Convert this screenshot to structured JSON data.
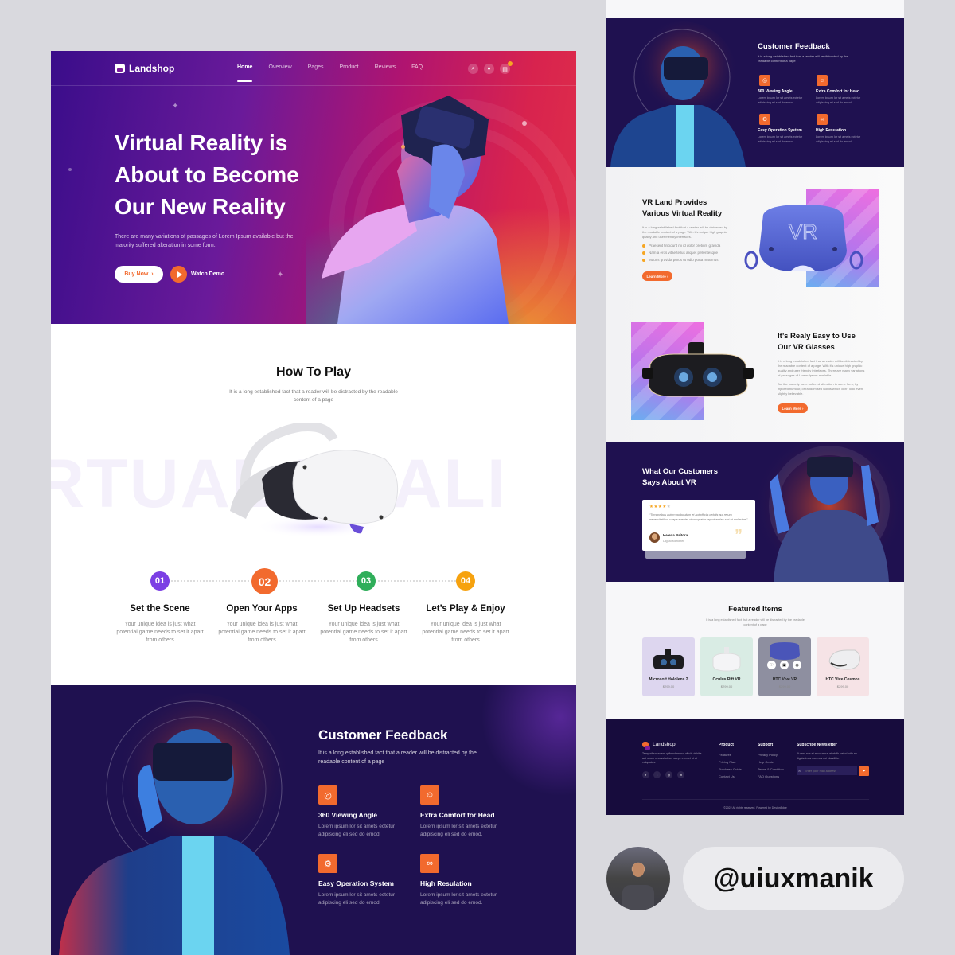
{
  "brand": "Landshop",
  "nav": {
    "links": [
      "Home",
      "Overview",
      "Pages",
      "Product",
      "Reviews",
      "FAQ"
    ],
    "active": "Home",
    "icons": [
      "search-icon",
      "user-icon",
      "cart-icon"
    ]
  },
  "hero": {
    "title_lines": [
      "Virtual Reality is",
      "About to Become",
      "Our New Reality"
    ],
    "subtitle": "There are many variations of passages of Lorem Ipsum available but the majority suffered alteration in some form.",
    "buy_label": "Buy Now",
    "watch_label": "Watch Demo"
  },
  "how_to_play": {
    "title": "How To Play",
    "subtitle": "It is a long established fact that a reader will be distracted by the readable content of a page",
    "bg_word": "RTUAL REALI",
    "steps": [
      {
        "num": "01",
        "title": "Set the Scene",
        "desc": "Your unique idea is just what potential game needs to set it apart from others",
        "color": "#7b3fe4"
      },
      {
        "num": "02",
        "title": "Open Your Apps",
        "desc": "Your unique idea is just what potential game needs to set it apart from others",
        "color": "#f26a2e"
      },
      {
        "num": "03",
        "title": "Set Up Headsets",
        "desc": "Your unique idea is just what potential game needs to set it apart from others",
        "color": "#2fae5a"
      },
      {
        "num": "04",
        "title": "Let’s Play & Enjoy",
        "desc": "Your unique idea is just what potential game needs to set it apart from others",
        "color": "#f6a20f"
      }
    ]
  },
  "feedback": {
    "title": "Customer Feedback",
    "subtitle": "It is a long established fact that a reader will be distracted by the readable content of a page",
    "features": [
      {
        "title": "360 Viewing Angle",
        "desc": "Lorem ipsum lor sit amets ectetur adipiscing eli sed do emod.",
        "icon": "vr-headset-icon"
      },
      {
        "title": "Extra Comfort for Head",
        "desc": "Lorem ipsum lor sit amets ectetur adipiscing eli sed do emod.",
        "icon": "head-comfort-icon"
      },
      {
        "title": "Easy Operation System",
        "desc": "Lorem ipsum lor sit amets ectetur adipiscing eli sed do emod.",
        "icon": "operation-icon"
      },
      {
        "title": "High Resulation",
        "desc": "Lorem ipsum lor sit amets ectetur adipiscing eli sed do emod.",
        "icon": "resolution-icon"
      }
    ]
  },
  "vr_land": {
    "title_lines": [
      "VR Land Provides",
      "Various Virtual Reality"
    ],
    "desc": "It is a long established fact that a reader will be distracted by the readable content of a page. With it's unique high graphic quality and user friendly interfaces.",
    "bullets": [
      "Praesent tincidunt mi id dolor pretium gravida",
      "Nam a eros vitae tellus aliquet pellentesque",
      "Mauris gravida purus ut odio porta maximus"
    ],
    "button": "Learn More",
    "visor_text": "VR"
  },
  "easy_use": {
    "title_lines": [
      "It’s Realy Easy to Use",
      "Our VR Glasses"
    ],
    "desc1": "It is a long established fact that a reader will be distracted by the readable content of a page. With it's unique high graphic quality and user friendly interfaces. There are many variations of passages of Lorem Ipsum available.",
    "desc2": "But the majority have suffered alteration in some form, by injected humour, or randomised words which don't look even slightly believable.",
    "button": "Learn More"
  },
  "testimonial": {
    "title_lines": [
      "What Our Customers",
      "Says About VR"
    ],
    "rating": 4,
    "rating_max": 5,
    "quote": "“Temporibus autem quibusdam et aut officiis debitis aut rerum necessitatibus saepe eveniet ut voluptates repudiandae sint et molestiae”",
    "name": "Helena Paitora",
    "role": "Digital Marketer"
  },
  "featured": {
    "title": "Featured Items",
    "subtitle": "It is a long established fact that a reader will be distracted by the readable content of a page",
    "items": [
      {
        "name": "Microsoft Hololens 2",
        "price": "$299.00",
        "bg": "#ddd6ef"
      },
      {
        "name": "Oculus Rift VR",
        "price": "$299.00",
        "bg": "#d9ece4"
      },
      {
        "name": "HTC Vive VR",
        "price": "$299.00",
        "bg": "#8e8fa0"
      },
      {
        "name": "HTC Vive Cosmos",
        "price": "$299.00",
        "bg": "#f6e3e6"
      }
    ]
  },
  "footer": {
    "about": "Temporibus autem quibusdam aut officiis debitis aut rerum necessitatibus saepe eveniet ut et voluptates.",
    "social": [
      "facebook-icon",
      "twitter-icon",
      "instagram-icon",
      "linkedin-icon"
    ],
    "product_title": "Product",
    "product_links": [
      "Features",
      "Pricing Plan",
      "Purchase Guide",
      "Contact Us"
    ],
    "support_title": "Support",
    "support_links": [
      "Privacy Policy",
      "Help Center",
      "Terms & Condition",
      "FAQ Questions"
    ],
    "newsletter_title": "Subscribe Newsletter",
    "newsletter_desc": "At vero eos et accusamus etiabilih iustod odio en dignissimos ducimus qui blandiitis.",
    "email_placeholder": "Enter your mail address",
    "copyright": "©2022 All rights reserved. Powered by DesignEdge"
  },
  "credit": {
    "handle": "@uiuxmanik"
  },
  "colors": {
    "accent": "#f26a2e",
    "dark": "#1f1150",
    "footer": "#170c3d"
  }
}
